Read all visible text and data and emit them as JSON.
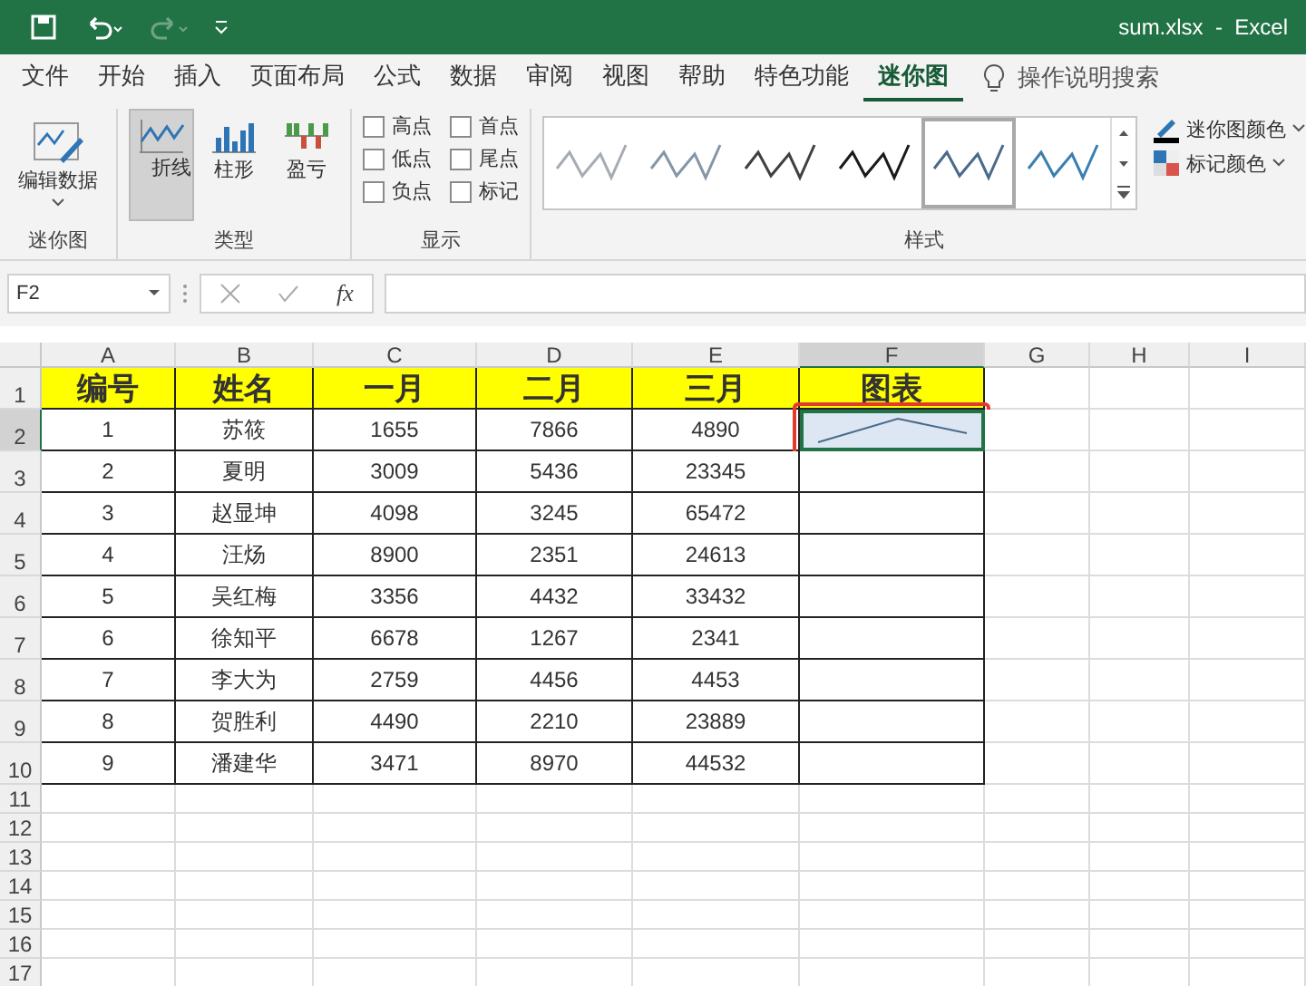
{
  "window": {
    "title": "sum.xlsx  -  Excel"
  },
  "tabs": [
    {
      "label": "文件",
      "selected": false
    },
    {
      "label": "开始",
      "selected": false
    },
    {
      "label": "插入",
      "selected": false
    },
    {
      "label": "页面布局",
      "selected": false
    },
    {
      "label": "公式",
      "selected": false
    },
    {
      "label": "数据",
      "selected": false
    },
    {
      "label": "审阅",
      "selected": false
    },
    {
      "label": "视图",
      "selected": false
    },
    {
      "label": "帮助",
      "selected": false
    },
    {
      "label": "特色功能",
      "selected": false
    },
    {
      "label": "迷你图",
      "selected": true
    }
  ],
  "tell_me": "操作说明搜索",
  "ribbon": {
    "sparkline_group": {
      "button": "编辑数据",
      "label": "迷你图"
    },
    "type_group": {
      "label": "类型",
      "types": [
        {
          "label": "折线",
          "kind": "line",
          "selected": true
        },
        {
          "label": "柱形",
          "kind": "column",
          "selected": false
        },
        {
          "label": "盈亏",
          "kind": "winloss",
          "selected": false
        }
      ]
    },
    "show_group": {
      "label": "显示",
      "options": [
        {
          "label": "高点",
          "checked": false
        },
        {
          "label": "首点",
          "checked": false
        },
        {
          "label": "低点",
          "checked": false
        },
        {
          "label": "尾点",
          "checked": false
        },
        {
          "label": "负点",
          "checked": false
        },
        {
          "label": "标记",
          "checked": false
        }
      ]
    },
    "style_group": {
      "label": "样式",
      "styles": [
        {
          "color": "#a6acb3",
          "selected": false
        },
        {
          "color": "#8596a8",
          "selected": false
        },
        {
          "color": "#404040",
          "selected": false
        },
        {
          "color": "#1a1a1a",
          "selected": false
        },
        {
          "color": "#4a6a8a",
          "selected": true
        },
        {
          "color": "#3a7fb0",
          "selected": false
        }
      ],
      "sparkline_color": "迷你图颜色",
      "marker_color": "标记颜色"
    }
  },
  "formula_bar": {
    "name_box": "F2",
    "fx": "fx"
  },
  "sheet": {
    "columns": [
      {
        "label": "A",
        "selected": false
      },
      {
        "label": "B",
        "selected": false
      },
      {
        "label": "C",
        "selected": false
      },
      {
        "label": "D",
        "selected": false
      },
      {
        "label": "E",
        "selected": false
      },
      {
        "label": "F",
        "selected": true
      },
      {
        "label": "G",
        "selected": false
      },
      {
        "label": "H",
        "selected": false
      },
      {
        "label": "I",
        "selected": false
      }
    ],
    "rows": [
      {
        "number": "1",
        "kind": "header",
        "selected": false,
        "cells": [
          "编号",
          "姓名",
          "一月",
          "二月",
          "三月",
          "图表"
        ]
      },
      {
        "number": "2",
        "kind": "data",
        "selected": true,
        "sparkline": true,
        "cells": [
          "1",
          "苏筱",
          "1655",
          "7866",
          "4890"
        ]
      },
      {
        "number": "3",
        "kind": "data",
        "selected": false,
        "sparkline": false,
        "cells": [
          "2",
          "夏明",
          "3009",
          "5436",
          "23345"
        ]
      },
      {
        "number": "4",
        "kind": "data",
        "selected": false,
        "sparkline": false,
        "cells": [
          "3",
          "赵显坤",
          "4098",
          "3245",
          "65472"
        ]
      },
      {
        "number": "5",
        "kind": "data",
        "selected": false,
        "sparkline": false,
        "cells": [
          "4",
          "汪炀",
          "8900",
          "2351",
          "24613"
        ]
      },
      {
        "number": "6",
        "kind": "data",
        "selected": false,
        "sparkline": false,
        "cells": [
          "5",
          "吴红梅",
          "3356",
          "4432",
          "33432"
        ]
      },
      {
        "number": "7",
        "kind": "data",
        "selected": false,
        "sparkline": false,
        "cells": [
          "6",
          "徐知平",
          "6678",
          "1267",
          "2341"
        ]
      },
      {
        "number": "8",
        "kind": "data",
        "selected": false,
        "sparkline": false,
        "cells": [
          "7",
          "李大为",
          "2759",
          "4456",
          "4453"
        ]
      },
      {
        "number": "9",
        "kind": "data",
        "selected": false,
        "sparkline": false,
        "cells": [
          "8",
          "贺胜利",
          "4490",
          "2210",
          "23889"
        ]
      },
      {
        "number": "10",
        "kind": "data",
        "selected": false,
        "sparkline": false,
        "cells": [
          "9",
          "潘建华",
          "3471",
          "8970",
          "44532"
        ]
      },
      {
        "number": "11",
        "kind": "empty",
        "selected": false
      },
      {
        "number": "12",
        "kind": "empty",
        "selected": false
      },
      {
        "number": "13",
        "kind": "empty",
        "selected": false
      },
      {
        "number": "14",
        "kind": "empty",
        "selected": false
      },
      {
        "number": "15",
        "kind": "empty",
        "selected": false
      },
      {
        "number": "16",
        "kind": "empty",
        "selected": false
      },
      {
        "number": "17",
        "kind": "empty",
        "selected": false
      }
    ]
  }
}
